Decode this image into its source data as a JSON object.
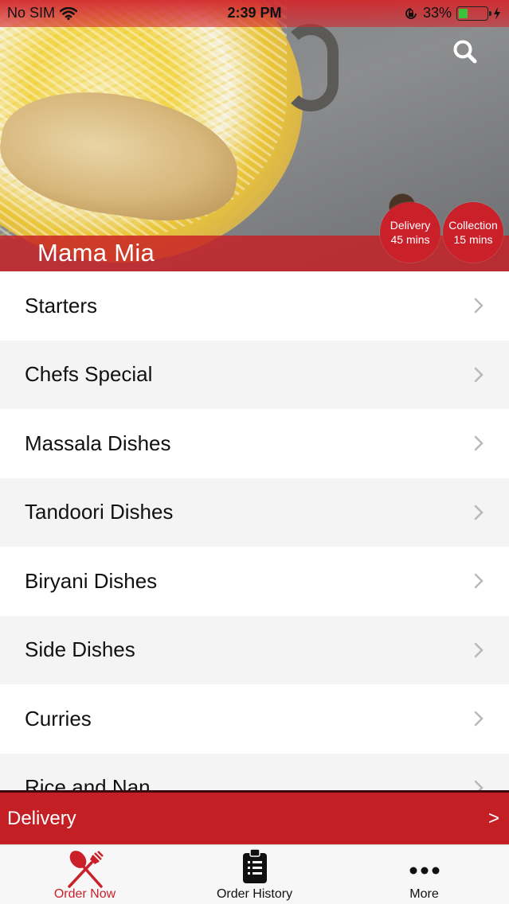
{
  "status_bar": {
    "carrier": "No SIM",
    "time": "2:39 PM",
    "battery": "33%",
    "battery_level": 0.33,
    "battery_color": "#3cc13b"
  },
  "hero": {
    "restaurant_name": "Mama Mia",
    "delivery_label": "Delivery",
    "delivery_time": "45 mins",
    "collection_label": "Collection",
    "collection_time": "15 mins",
    "accent_color": "#c9202a"
  },
  "menu": {
    "categories": [
      "Starters",
      "Chefs Special",
      "Massala Dishes",
      "Tandoori Dishes",
      "Biryani Dishes",
      "Side Dishes",
      "Curries",
      "Rice and Nan"
    ]
  },
  "delivery_bar": {
    "label": "Delivery",
    "arrow": ">"
  },
  "tabs": [
    {
      "label": "Order Now",
      "icon": "fork-knife-icon",
      "active": true
    },
    {
      "label": "Order History",
      "icon": "clipboard-icon",
      "active": false
    },
    {
      "label": "More",
      "icon": "more-dots-icon",
      "active": false
    }
  ]
}
